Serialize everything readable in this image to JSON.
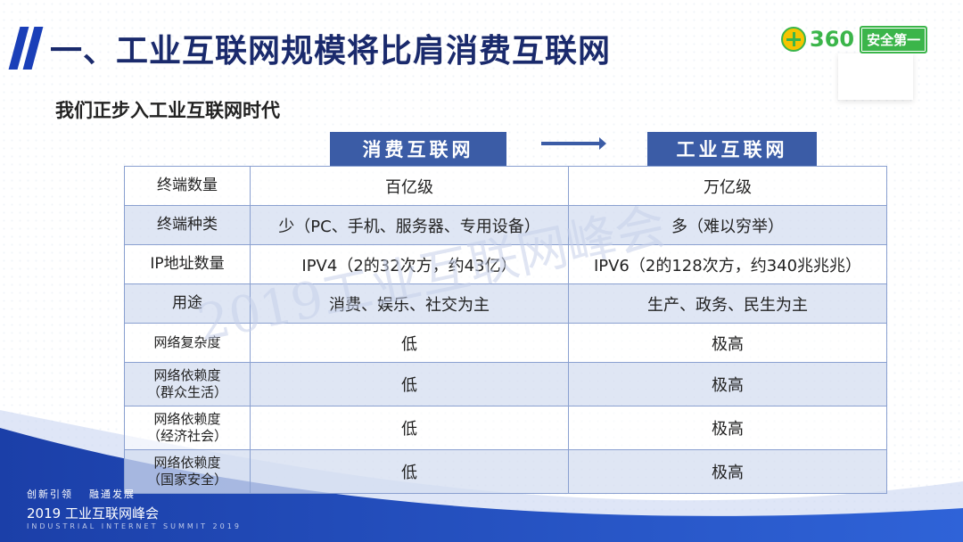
{
  "title": "一、工业互联网规模将比肩消费互联网",
  "subtitle": "我们正步入工业互联网时代",
  "logo": {
    "number": "360",
    "badge": "安全第一"
  },
  "columns": {
    "consumer": "消费互联网",
    "industrial": "工业互联网"
  },
  "rows": [
    {
      "label": "终端数量",
      "consumer": "百亿级",
      "industrial": "万亿级"
    },
    {
      "label": "终端种类",
      "consumer": "少（PC、手机、服务器、专用设备）",
      "industrial": "多（难以穷举）"
    },
    {
      "label": "IP地址数量",
      "consumer": "IPV4（2的32次方，约43亿）",
      "industrial": "IPV6（2的128次方，约340兆兆兆）"
    },
    {
      "label": "用途",
      "consumer": "消费、娱乐、社交为主",
      "industrial": "生产、政务、民生为主"
    },
    {
      "label": "网络复杂度",
      "consumer": "低",
      "industrial": "极高"
    },
    {
      "label": "网络依赖度",
      "label_sub": "（群众生活）",
      "consumer": "低",
      "industrial": "极高"
    },
    {
      "label": "网络依赖度",
      "label_sub": "（经济社会）",
      "consumer": "低",
      "industrial": "极高"
    },
    {
      "label": "网络依赖度",
      "label_sub": "（国家安全）",
      "consumer": "低",
      "industrial": "极高"
    }
  ],
  "watermark": "2019工业互联网峰会",
  "footer": {
    "slogan_left": "创新引领",
    "slogan_right": "融通发展",
    "event": "2019 工业互联网峰会",
    "event_en": "INDUSTRIAL INTERNET SUMMIT 2019"
  }
}
